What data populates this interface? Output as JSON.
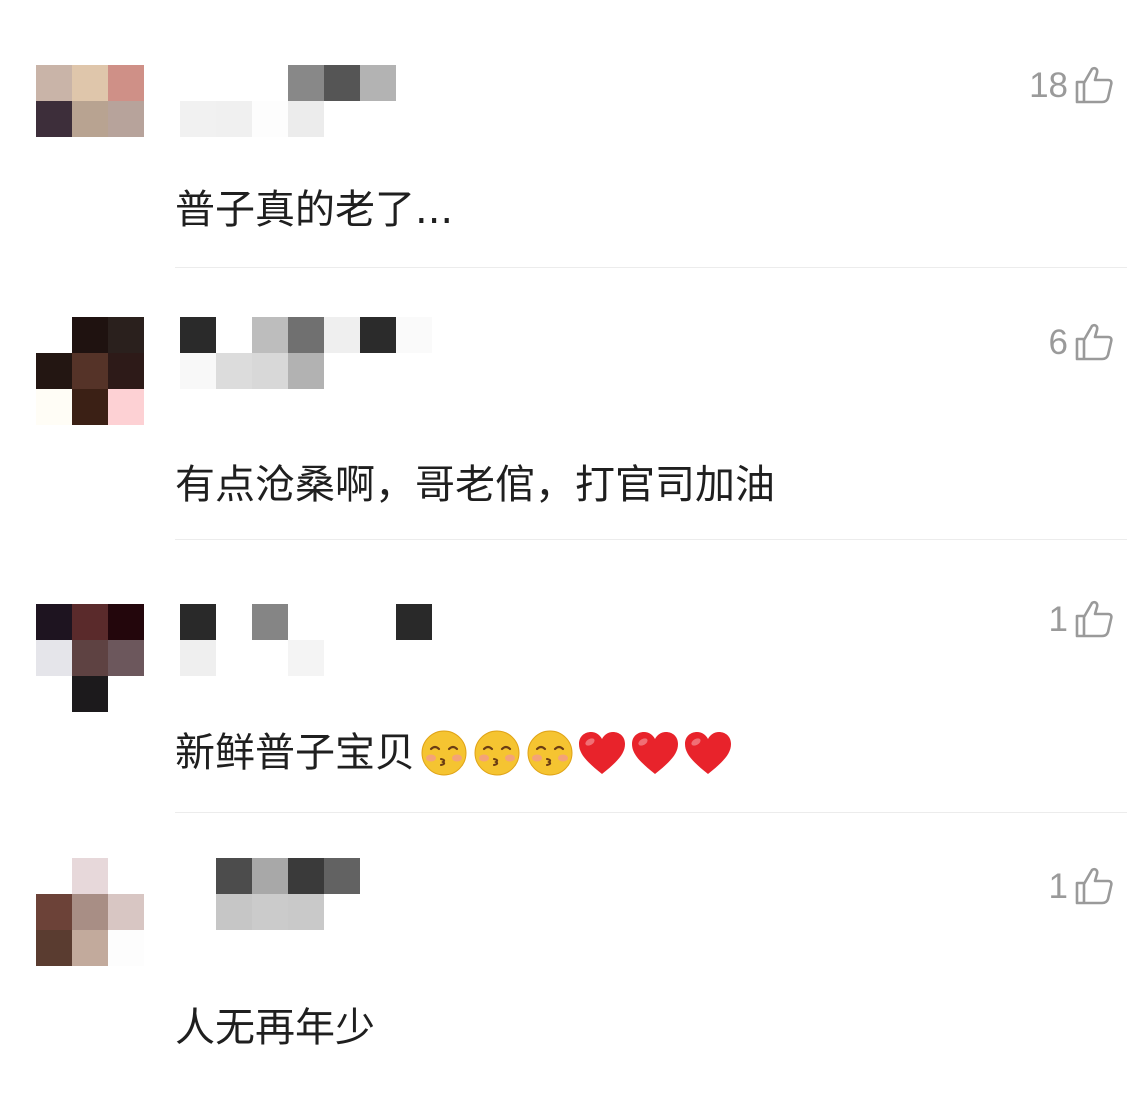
{
  "comments": [
    {
      "text": "普子真的老了...",
      "likes": "18",
      "avatar_pixels": [
        [
          "#c9b4a8",
          "#dfc6ab",
          "#cf9087"
        ],
        [
          "#3d2e3a",
          "#b8a391",
          "#b7a39b"
        ]
      ],
      "name_pixels": [
        [
          "#ffffff",
          "#ffffff",
          "#ffffff",
          "#888888",
          "#555555",
          "#b3b3b3"
        ],
        [
          "#f1f1f1",
          "#f0f0f0",
          "#fdfdfd",
          "#ececec",
          "#ffffff",
          "#ffffff"
        ]
      ]
    },
    {
      "text": "有点沧桑啊，哥老倌，打官司加油",
      "likes": "6",
      "avatar_pixels": [
        [
          "#ffffff",
          "#1f1210",
          "#2a201d"
        ],
        [
          "#231612",
          "#553328",
          "#2d1a18"
        ],
        [
          "#fffdf6",
          "#3b2015",
          "#fdd1d4"
        ]
      ],
      "name_pixels": [
        [
          "#2a2a2a",
          "#ffffff",
          "#bdbdbd",
          "#707070",
          "#efefef",
          "#2b2b2b",
          "#fafafa"
        ],
        [
          "#f8f8f8",
          "#dcdcdc",
          "#d8d8d8",
          "#b2b2b2",
          "#ffffff",
          "#ffffff",
          "#ffffff"
        ]
      ]
    },
    {
      "text": "新鲜普子宝贝",
      "likes": "1",
      "emoji_kiss_count": 3,
      "emoji_heart_count": 3,
      "colors": {
        "heart": "#e8232b",
        "kiss_face": "#f5c431"
      },
      "avatar_pixels": [
        [
          "#1e1420",
          "#5a2a2b",
          "#23060c"
        ],
        [
          "#e5e5ea",
          "#5e4242",
          "#6c575c"
        ],
        [
          "#ffffff",
          "#1c1a1c",
          "#ffffff"
        ]
      ],
      "name_pixels": [
        [
          "#292929",
          "#ffffff",
          "#858585",
          "#ffffff",
          "#ffffff",
          "#ffffff",
          "#292929"
        ],
        [
          "#efefef",
          "#ffffff",
          "#ffffff",
          "#f4f4f4",
          "#ffffff",
          "#ffffff",
          "#ffffff"
        ]
      ]
    },
    {
      "text": "人无再年少",
      "likes": "1",
      "avatar_pixels": [
        [
          "#ffffff",
          "#e7d8da",
          "#ffffff"
        ],
        [
          "#6c4238",
          "#a88e85",
          "#d8c6c3"
        ],
        [
          "#5a3c30",
          "#c2aa9c",
          "#fdfdfd"
        ]
      ],
      "name_pixels": [
        [
          "#ffffff",
          "#4c4c4c",
          "#a8a8a8",
          "#3a3a3a",
          "#626262"
        ],
        [
          "#ffffff",
          "#c6c6c6",
          "#cbcbcb",
          "#c9c9c9",
          "#ffffff"
        ]
      ]
    }
  ]
}
